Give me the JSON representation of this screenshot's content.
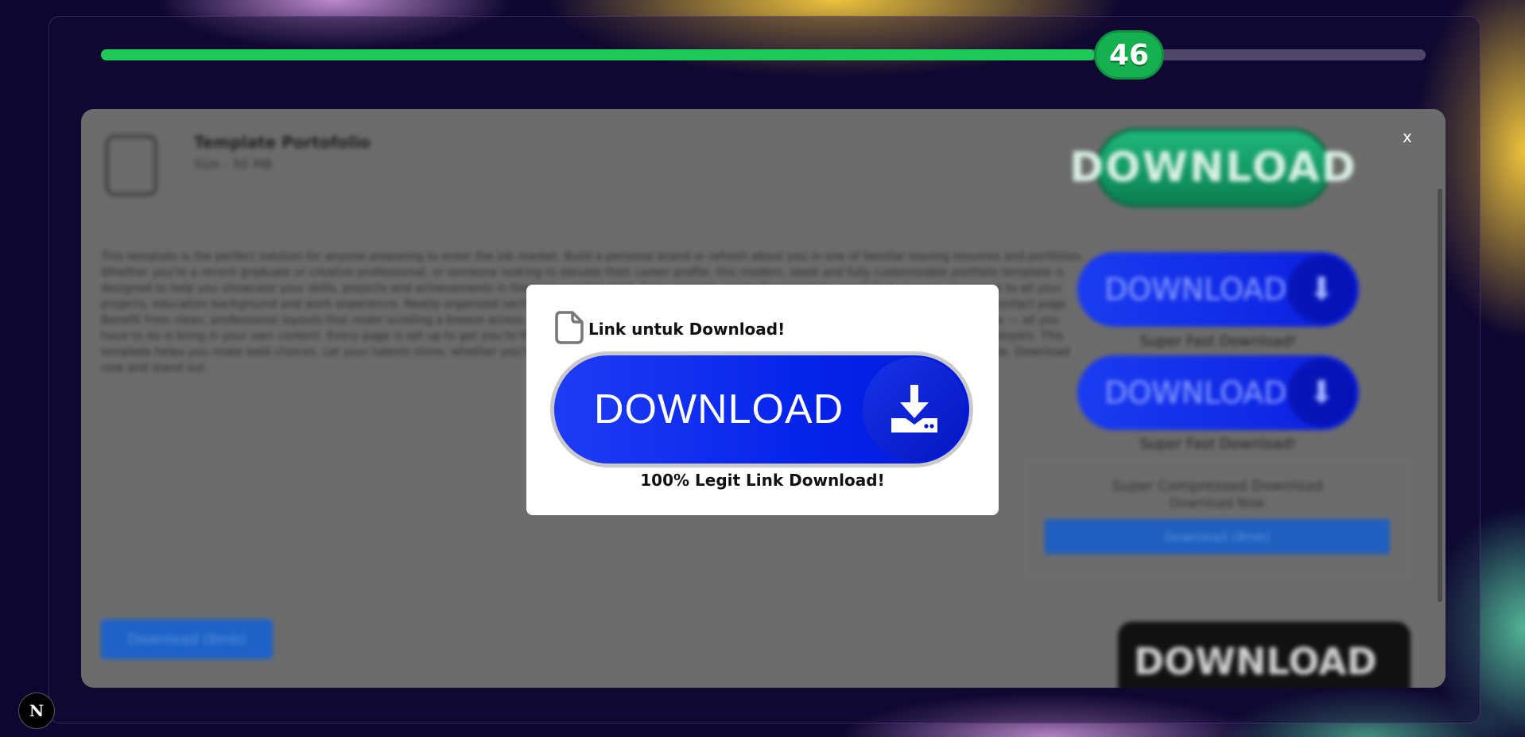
{
  "progress": {
    "value": 46,
    "fraction": 0.75,
    "color": "#1ec95a"
  },
  "background_page": {
    "file_title": "Template Portofolio",
    "file_size": "Size : 50 MB",
    "description": "This template is the perfect solution for anyone preparing to enter the job market. Build a personal brand or refresh about you in one of familiar leaving resumes and portfolios. Whether you're a recent graduate or creative professional, or someone looking to elevate their career profile, this modern, sleek and fully customizable portfolio template is designed to help you showcase your skills, projects and achievements in the best possible light. From projects, inside the template, you'll find space to showcase to all your projects, education background and work experience. Neatly organized sections and fonts, a presentation section where you can display your best work, and a contact page. Benefit from clean, professional layouts that make scrolling a breeze across website etc. The file is approximately 50 MB. All design elements are already in place — all you have to do is bring in your own content. Every page is set up to get you to the 'I have it' ... it makes it a complete job market, standing out to your potential employers. This template helps you make bold choices. Let your talents shine, whether you're applying for a job, pitching your services, or just want to show off your creative side. Download now and stand out.",
    "download_button_text": "DOWNLOAD",
    "side_buttons": [
      {
        "label": "DOWNLOAD",
        "caption": "Super Fast Download!"
      },
      {
        "label": "DOWNLOAD",
        "caption": "Super Fast Download!"
      }
    ],
    "compressed_card": {
      "title": "Super Compressed Download",
      "subtitle": "Download Now",
      "button": "Download (8mb)"
    },
    "bottom_left_button": "Download (8mb)",
    "bottom_right_button": "DOWNLOAD"
  },
  "close_label": "x",
  "modal": {
    "title": "Link untuk Download!",
    "button_label": "DOWNLOAD",
    "caption": "100% Legit Link Download!",
    "icons": {
      "file": "file-icon",
      "download": "download-tray-icon"
    }
  },
  "next_badge": "N",
  "colors": {
    "accent_blue": "#0624ea",
    "green": "#1ec95a",
    "dark_bg": "#0c0630"
  }
}
